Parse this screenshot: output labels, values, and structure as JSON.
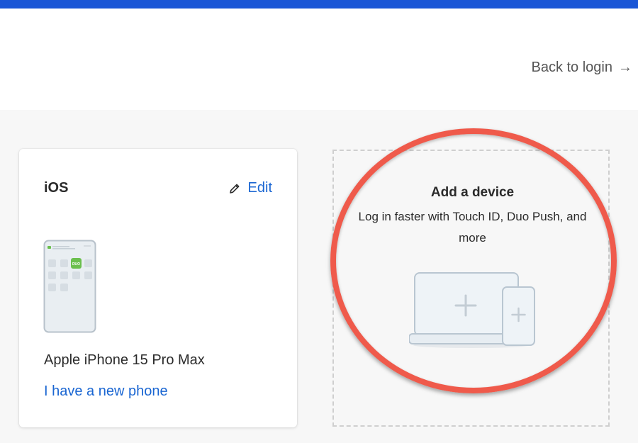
{
  "header": {
    "back_label": "Back to login",
    "back_icon": "arrow-right-icon"
  },
  "device_card": {
    "platform": "iOS",
    "edit_label": "Edit",
    "device_name": "Apple iPhone 15 Pro Max",
    "new_phone_label": "I have a new phone",
    "app_badge": "DUO"
  },
  "add_device": {
    "title": "Add a device",
    "description": "Log in faster with Touch ID, Duo Push, and more"
  },
  "colors": {
    "top_bar": "#1a56d6",
    "link": "#1a66d2",
    "highlight": "#ef5a4b",
    "duo_green": "#6bbf4e"
  }
}
